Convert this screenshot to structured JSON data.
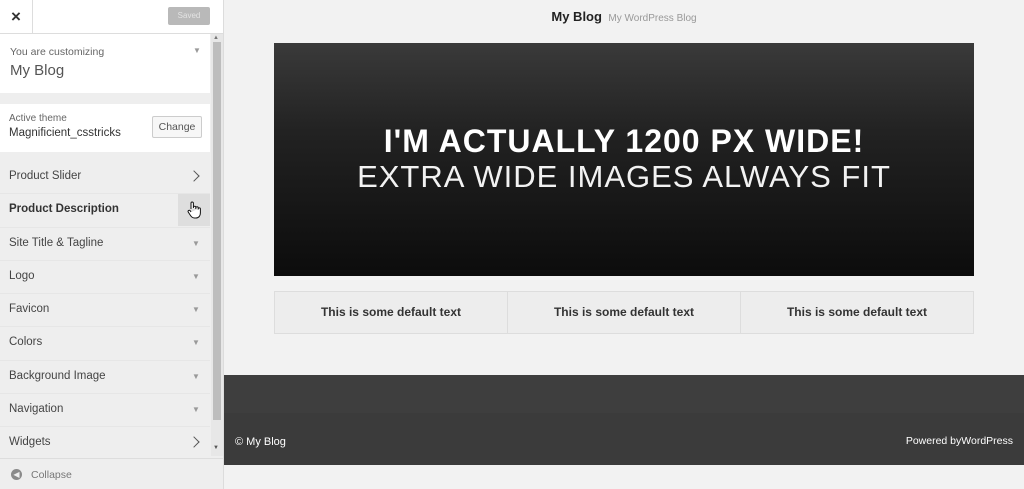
{
  "sidebar": {
    "close_icon": "×",
    "saved_label": "Saved",
    "customizing_label": "You are customizing",
    "site_name": "My Blog",
    "active_theme_label": "Active theme",
    "theme_name": "Magnificient_csstricks",
    "change_label": "Change",
    "sections": [
      {
        "label": "Product Slider",
        "icon": "chevron-right"
      },
      {
        "label": "Product Description",
        "icon": "hand-cursor"
      },
      {
        "label": "Site Title & Tagline",
        "icon": "triangle-down"
      },
      {
        "label": "Logo",
        "icon": "triangle-down"
      },
      {
        "label": "Favicon",
        "icon": "triangle-down"
      },
      {
        "label": "Colors",
        "icon": "triangle-down"
      },
      {
        "label": "Background Image",
        "icon": "triangle-down"
      },
      {
        "label": "Navigation",
        "icon": "triangle-down"
      },
      {
        "label": "Widgets",
        "icon": "chevron-right"
      }
    ],
    "collapse_label": "Collapse"
  },
  "preview": {
    "site_title": "My Blog",
    "site_tagline": "My WordPress Blog",
    "hero_line1": "I'M ACTUALLY 1200 PX WIDE!",
    "hero_line2": "EXTRA WIDE IMAGES ALWAYS FIT",
    "boxes": [
      "This is some default text",
      "This is some default text",
      "This is some default text"
    ],
    "copyright": "© My Blog",
    "powered": "Powered byWordPress"
  },
  "colors": {
    "sidebar_bg": "#eeeeee",
    "hero_bg": "#111111",
    "footer_bg": "#3b3b3b"
  }
}
